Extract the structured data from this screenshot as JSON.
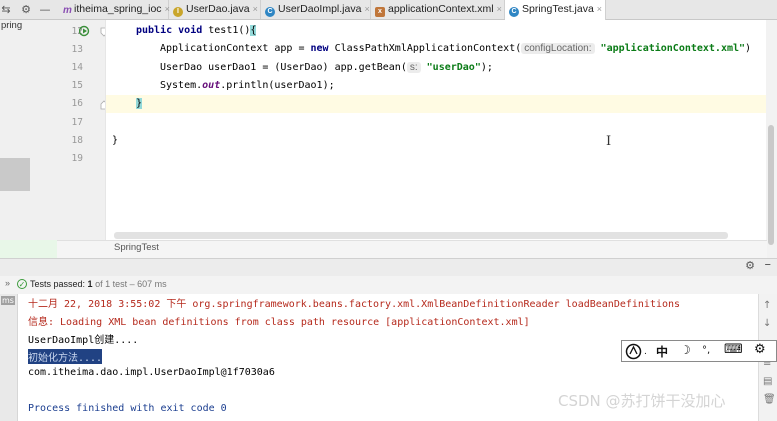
{
  "tabs": [
    {
      "label": "itheima_spring_ioc",
      "icon": "m"
    },
    {
      "label": "UserDao.java",
      "icon": "i"
    },
    {
      "label": "UserDaoImpl.java",
      "icon": "c"
    },
    {
      "label": "applicationContext.xml",
      "icon": "x"
    },
    {
      "label": "SpringTest.java",
      "icon": "c",
      "active": true
    }
  ],
  "tab_close_glyph": "×",
  "left_panel": {
    "label": "pring"
  },
  "editor": {
    "line_numbers": [
      "12",
      "13",
      "14",
      "15",
      "16",
      "17",
      "18",
      "19"
    ],
    "line12": {
      "kw1": "public",
      "kw2": "void",
      "rest": " test1()",
      "brace": "{"
    },
    "line13": {
      "pre": "ApplicationContext app = ",
      "kw": "new",
      "mid": " ClassPathXmlApplicationContext(",
      "hint": "configLocation:",
      "str": "\"applicationContext.xml\"",
      "post": ")"
    },
    "line14": {
      "pre": "UserDao userDao1 = (UserDao) app.getBean(",
      "hint": "s:",
      "str": "\"userDao\"",
      "post": ");"
    },
    "line15": {
      "pre": "System.",
      "field": "out",
      "post": ".println(userDao1);"
    },
    "line16": {
      "brace": "}"
    },
    "line18": {
      "brace": "}"
    },
    "footer_label": "SpringTest",
    "cursor_glyph": "I"
  },
  "run_panel": {
    "test_status": "Tests passed:",
    "test_count": "1",
    "test_detail": "of 1 test – 607 ms",
    "side_label": "ms"
  },
  "console_lines": [
    {
      "text": "十二月 22, 2018 3:55:02 下午 org.springframework.beans.factory.xml.XmlBeanDefinitionReader loadBeanDefinitions",
      "style": "red"
    },
    {
      "text": "信息: Loading XML bean definitions from class path resource [applicationContext.xml]",
      "style": "red"
    },
    {
      "text": "UserDaoImpl创建....",
      "style": "normal"
    },
    {
      "text": "初始化方法....",
      "style": "selected"
    },
    {
      "text": "com.itheima.dao.impl.UserDaoImpl@1f7030a6",
      "style": "normal"
    },
    {
      "text": "Process finished with exit code 0",
      "style": "blue"
    }
  ],
  "ime": {
    "mode": "中",
    "moon": "☽",
    "punct": "°,",
    "keyboard": "⌨",
    "settings": "⚙"
  },
  "watermark": "CSDN @苏打饼干没加心"
}
